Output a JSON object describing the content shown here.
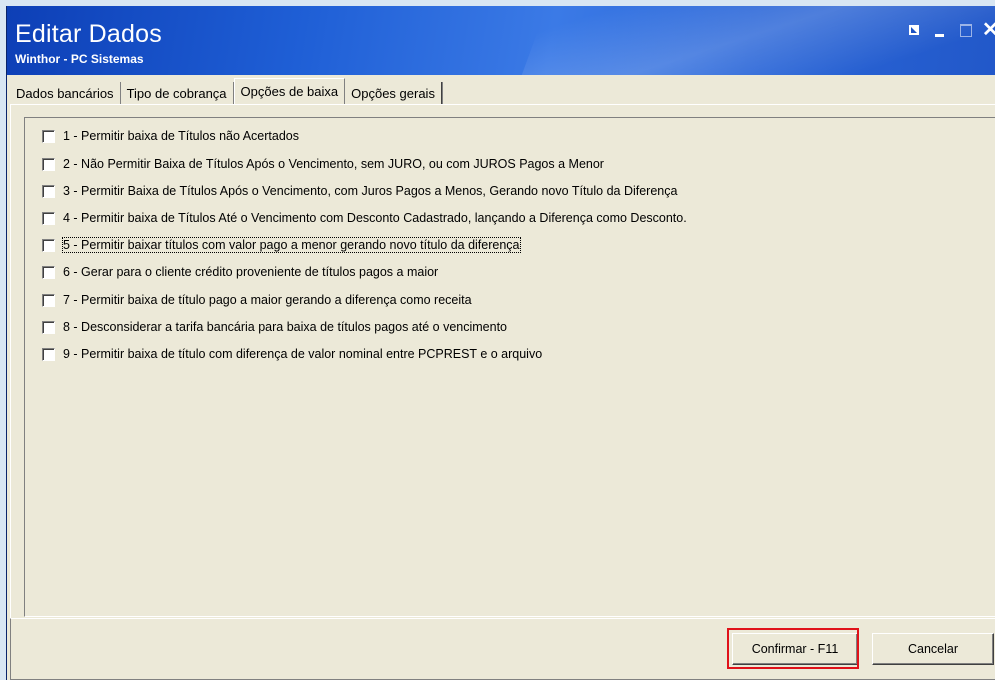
{
  "window": {
    "title": "Editar Dados",
    "subtitle": "Winthor - PC Sistemas",
    "controls": {
      "close_label": "✕"
    }
  },
  "tabs": [
    {
      "label": "Dados bancários",
      "active": false
    },
    {
      "label": "Tipo de cobrança",
      "active": false
    },
    {
      "label": "Opções de baixa",
      "active": true
    },
    {
      "label": "Opções gerais",
      "active": false
    }
  ],
  "options": [
    {
      "label": "1 - Permitir baixa de Títulos não Acertados",
      "checked": false
    },
    {
      "label": "2 - Não Permitir Baixa de Títulos Após o Vencimento, sem JURO, ou com JUROS Pagos a Menor",
      "checked": false
    },
    {
      "label": "3 - Permitir Baixa de Títulos Após o Vencimento, com Juros Pagos a Menos, Gerando novo Título da Diferença",
      "checked": false
    },
    {
      "label": "4 - Permitir baixa de Títulos Até o Vencimento com Desconto Cadastrado, lançando a Diferença como Desconto.",
      "checked": false
    },
    {
      "label": "5 - Permitir baixar títulos com valor pago a menor gerando novo título da diferença",
      "checked": false,
      "focused": true
    },
    {
      "label": "6 - Gerar para o cliente crédito proveniente de títulos pagos a maior",
      "checked": false
    },
    {
      "label": "7 - Permitir baixa de título pago a maior gerando a diferença como receita",
      "checked": false
    },
    {
      "label": "8 - Desconsiderar a tarifa bancária para baixa de títulos pagos até o vencimento",
      "checked": false
    },
    {
      "label": "9 - Permitir baixa de título com diferença de valor nominal entre PCPREST e o arquivo",
      "checked": false
    }
  ],
  "footer": {
    "confirm_label": "Confirmar - F11",
    "cancel_label": "Cancelar",
    "highlight_color": "#e0121a"
  },
  "colors": {
    "titlebar": "#1f5fd6",
    "face": "#ece9d8"
  }
}
